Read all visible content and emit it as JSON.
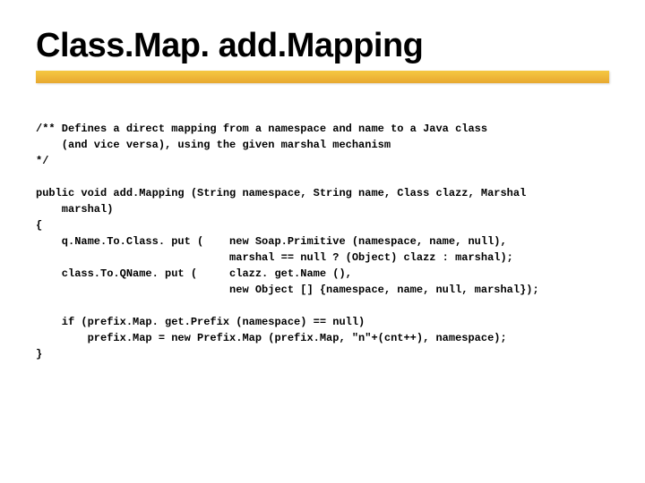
{
  "title": "Class.Map. add.Mapping",
  "code": {
    "comment_l1": "/** Defines a direct mapping from a namespace and name to a Java class",
    "comment_l2": "    (and vice versa), using the given marshal mechanism",
    "comment_l3": "*/",
    "sig_l1": "public void add.Mapping (String namespace, String name, Class clazz, Marshal",
    "sig_l2": "    marshal)",
    "brace_open": "{",
    "body_l1": "    q.Name.To.Class. put (    new Soap.Primitive (namespace, name, null),",
    "body_l2": "                              marshal == null ? (Object) clazz : marshal);",
    "body_l3": "    class.To.QName. put (     clazz. get.Name (),",
    "body_l4": "                              new Object [] {namespace, name, null, marshal});",
    "body_l5": "    if (prefix.Map. get.Prefix (namespace) == null)",
    "body_l6": "        prefix.Map = new Prefix.Map (prefix.Map, \"n\"+(cnt++), namespace);",
    "brace_close": "}"
  }
}
